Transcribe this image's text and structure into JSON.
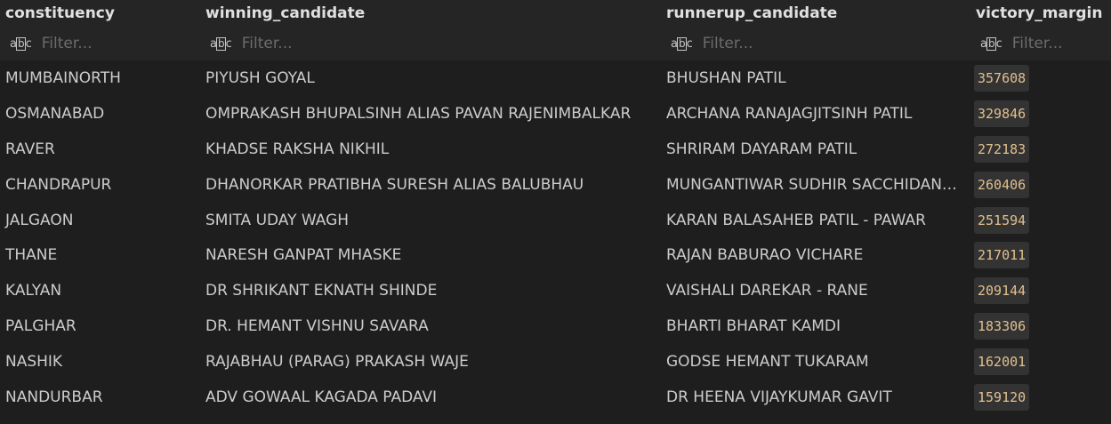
{
  "columns": {
    "constituency": "constituency",
    "winning_candidate": "winning_candidate",
    "runnerup_candidate": "runnerup_candidate",
    "victory_margin": "victory_margin"
  },
  "filter": {
    "type_icon": "abc",
    "placeholder": "Filter..."
  },
  "rows": [
    {
      "constituency": "MUMBAINORTH",
      "winning_candidate": "PIYUSH GOYAL",
      "runnerup_candidate": "BHUSHAN PATIL",
      "victory_margin": "357608"
    },
    {
      "constituency": "OSMANABAD",
      "winning_candidate": "OMPRAKASH BHUPALSINH ALIAS PAVAN RAJENIMBALKAR",
      "runnerup_candidate": "ARCHANA RANAJAGJITSINH PATIL",
      "victory_margin": "329846"
    },
    {
      "constituency": "RAVER",
      "winning_candidate": "KHADSE RAKSHA NIKHIL",
      "runnerup_candidate": "SHRIRAM DAYARAM PATIL",
      "victory_margin": "272183"
    },
    {
      "constituency": "CHANDRAPUR",
      "winning_candidate": "DHANORKAR PRATIBHA SURESH ALIAS BALUBHAU",
      "runnerup_candidate": "MUNGANTIWAR SUDHIR SACCHIDANAND",
      "victory_margin": "260406"
    },
    {
      "constituency": "JALGAON",
      "winning_candidate": "SMITA UDAY WAGH",
      "runnerup_candidate": "KARAN BALASAHEB PATIL - PAWAR",
      "victory_margin": "251594"
    },
    {
      "constituency": "THANE",
      "winning_candidate": "NARESH GANPAT MHASKE",
      "runnerup_candidate": "RAJAN BABURAO VICHARE",
      "victory_margin": "217011"
    },
    {
      "constituency": "KALYAN",
      "winning_candidate": "DR SHRIKANT EKNATH SHINDE",
      "runnerup_candidate": "VAISHALI DAREKAR - RANE",
      "victory_margin": "209144"
    },
    {
      "constituency": "PALGHAR",
      "winning_candidate": "DR. HEMANT VISHNU SAVARA",
      "runnerup_candidate": "BHARTI BHARAT KAMDI",
      "victory_margin": "183306"
    },
    {
      "constituency": "NASHIK",
      "winning_candidate": "RAJABHAU (PARAG) PRAKASH WAJE",
      "runnerup_candidate": "GODSE HEMANT TUKARAM",
      "victory_margin": "162001"
    },
    {
      "constituency": "NANDURBAR",
      "winning_candidate": "ADV GOWAAL KAGADA PADAVI",
      "runnerup_candidate": "DR HEENA VIJAYKUMAR GAVIT",
      "victory_margin": "159120"
    }
  ]
}
